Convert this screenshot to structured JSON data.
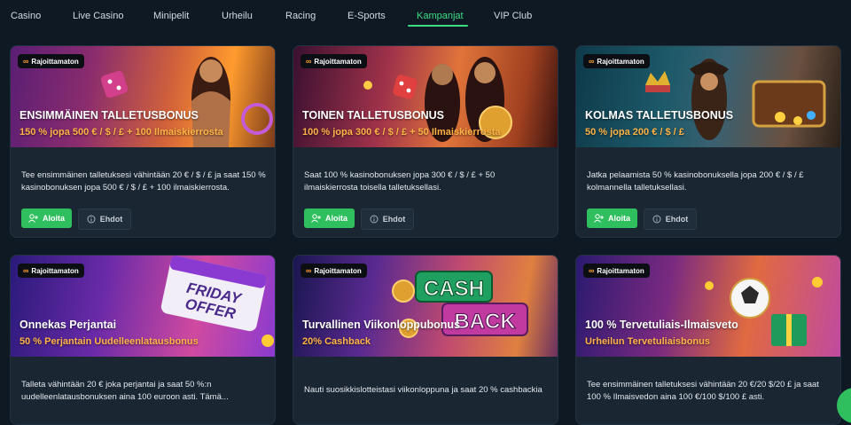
{
  "nav": {
    "items": [
      {
        "label": "Casino"
      },
      {
        "label": "Live Casino"
      },
      {
        "label": "Minipelit"
      },
      {
        "label": "Urheilu"
      },
      {
        "label": "Racing"
      },
      {
        "label": "E-Sports"
      },
      {
        "label": "Kampanjat",
        "active": true
      },
      {
        "label": "VIP Club"
      }
    ],
    "active_color": "#3ddc84"
  },
  "cards": [
    {
      "badge": "Rajoittamaton",
      "title": "ENSIMMÄINEN TALLETUSBONUS",
      "subtitle": "150 % jopa 500 € / $ / £ + 100 Ilmaiskierrosta",
      "description": "Tee ensimmäinen talletuksesi vähintään 20 € / $ / £ ja saat 150 % kasinobonuksen jopa 500 € / $ / £ + 100 ilmaiskierrosta.",
      "start_label": "Aloita",
      "terms_label": "Ehdot"
    },
    {
      "badge": "Rajoittamaton",
      "title": "TOINEN TALLETUSBONUS",
      "subtitle": "100 % jopa 300 € / $ / £ + 50 Ilmaiskierrosta",
      "description": "Saat 100 % kasinobonuksen jopa 300 € / $ / £ + 50 ilmaiskierrosta toisella talletuksellasi.",
      "start_label": "Aloita",
      "terms_label": "Ehdot"
    },
    {
      "badge": "Rajoittamaton",
      "title": "KOLMAS TALLETUSBONUS",
      "subtitle": "50 % jopa 200 € / $ / £",
      "description": "Jatka pelaamista 50 % kasinobonuksella jopa 200 € / $ / £ kolmannella talletuksellasi.",
      "start_label": "Aloita",
      "terms_label": "Ehdot"
    },
    {
      "badge": "Rajoittamaton",
      "title": "Onnekas Perjantai",
      "subtitle": "50 % Perjantain Uudelleenlatausbonus",
      "description": "Talleta vähintään 20 € joka perjantai ja saat 50 %:n uudelleenlatausbonuksen aina 100 euroon asti. Tämä...",
      "art_line1": "FRIDAY",
      "art_line2": "OFFER"
    },
    {
      "badge": "Rajoittamaton",
      "title": "Turvallinen Viikonloppubonus",
      "subtitle": "20% Cashback",
      "description": "Nauti suosikkislotteistasi viikonloppuna ja saat 20 % cashbackia",
      "art_line1": "CASH",
      "art_line2": "BACK"
    },
    {
      "badge": "Rajoittamaton",
      "title": "100 % Tervetuliais-Ilmaisveto",
      "subtitle": "Urheilun Tervetuliaisbonus",
      "description": "Tee ensimmäinen talletuksesi vähintään 20 €/20 $/20 £ ja saat 100 % Ilmaisvedon aina 100 €/100 $/100 £ asti."
    }
  ],
  "icons": {
    "infinity": "∞",
    "add_user": "add-user-icon",
    "info": "info-icon"
  },
  "colors": {
    "background": "#0f1923",
    "card": "#1a2632",
    "accent_green": "#2fbf5f",
    "subtitle_orange": "#ffb347"
  }
}
